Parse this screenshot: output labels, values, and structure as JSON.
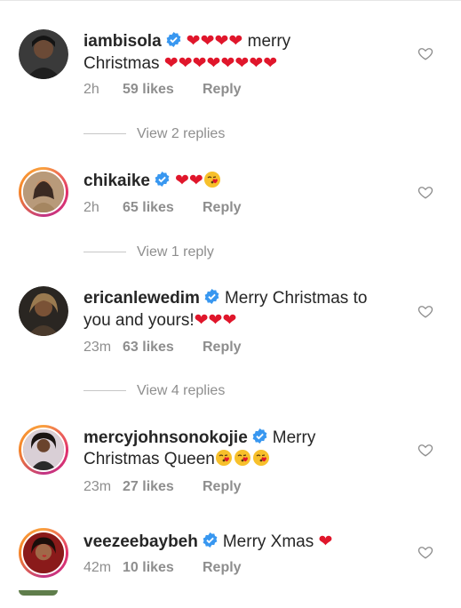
{
  "comments": [
    {
      "username": "iambisola",
      "verified": true,
      "text_line1": "merry",
      "text_line2": "Christmas",
      "hearts_line1": "❤❤❤❤",
      "hearts_line2": "❤❤❤❤❤❤❤❤",
      "time": "2h",
      "likes": "59 likes",
      "reply": "Reply",
      "view_replies": "View 2 replies"
    },
    {
      "username": "chikaike",
      "verified": true,
      "hearts": "❤❤",
      "time": "2h",
      "likes": "65 likes",
      "reply": "Reply",
      "view_replies": "View 1 reply"
    },
    {
      "username": "ericanlewedim",
      "verified": true,
      "text_line1": "Merry Christmas to",
      "text_line2": "you and yours!",
      "hearts": "❤❤❤",
      "time": "23m",
      "likes": "63 likes",
      "reply": "Reply",
      "view_replies": "View 4 replies"
    },
    {
      "username": "mercyjohnsonokojie",
      "verified": true,
      "text_line1": "Merry",
      "text_line2": "Christmas Queen",
      "time": "23m",
      "likes": "27 likes",
      "reply": "Reply"
    },
    {
      "username": "veezeebaybeh",
      "verified": true,
      "text_line1": "Merry Xmas",
      "hearts": "❤",
      "time": "42m",
      "likes": "10 likes",
      "reply": "Reply"
    }
  ],
  "icons": {
    "verified": "verified-badge-icon",
    "like": "heart-outline-icon",
    "kiss": "face-blowing-kiss-emoji"
  },
  "colors": {
    "verified_blue": "#3897f0",
    "heart_red": "#e0162b",
    "meta_gray": "#8e8e8e"
  }
}
